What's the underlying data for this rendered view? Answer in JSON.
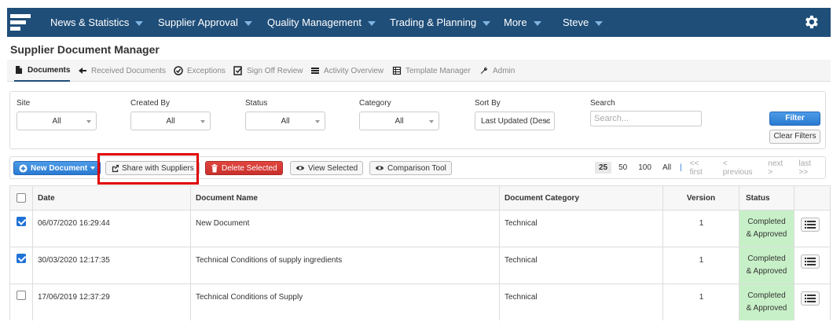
{
  "nav": {
    "items": [
      {
        "label": "News & Statistics"
      },
      {
        "label": "Supplier Approval"
      },
      {
        "label": "Quality Management"
      },
      {
        "label": "Trading & Planning"
      },
      {
        "label": "More"
      },
      {
        "label": "Steve"
      }
    ]
  },
  "page": {
    "title": "Supplier Document Manager"
  },
  "subnav": {
    "items": [
      {
        "label": "Documents",
        "icon": "document-icon"
      },
      {
        "label": "Received Documents",
        "icon": "arrow-left-icon"
      },
      {
        "label": "Exceptions",
        "icon": "check-circle-icon"
      },
      {
        "label": "Sign Off Review",
        "icon": "check-square-icon"
      },
      {
        "label": "Activity Overview",
        "icon": "list-icon"
      },
      {
        "label": "Template Manager",
        "icon": "table-icon"
      },
      {
        "label": "Admin",
        "icon": "wrench-icon"
      }
    ]
  },
  "filters": {
    "site": {
      "label": "Site",
      "value": "All"
    },
    "created_by": {
      "label": "Created By",
      "value": "All"
    },
    "status": {
      "label": "Status",
      "value": "All"
    },
    "category": {
      "label": "Category",
      "value": "All"
    },
    "sort_by": {
      "label": "Sort By",
      "value": "Last Updated (Desc"
    },
    "search": {
      "label": "Search",
      "placeholder": "Search..."
    },
    "filter_button": "Filter",
    "clear_button": "Clear Filters"
  },
  "toolbar": {
    "new_document": "New Document",
    "share": "Share with Suppliers",
    "delete": "Delete Selected",
    "view": "View Selected",
    "compare": "Comparison Tool"
  },
  "pager": {
    "sizes": [
      "25",
      "50",
      "100",
      "All"
    ],
    "separator": "|",
    "first": "<< first",
    "previous": "< previous",
    "next": "next >",
    "last": "last >>"
  },
  "table": {
    "headers": {
      "date": "Date",
      "name": "Document Name",
      "category": "Document Category",
      "version": "Version",
      "status": "Status"
    },
    "rows": [
      {
        "date": "06/07/2020 16:29:44",
        "name": "New Document",
        "category": "Technical",
        "version": "1",
        "status_line1": "Completed",
        "status_line2": "& Approved",
        "checked": true
      },
      {
        "date": "30/03/2020 12:17:35",
        "name": "Technical Conditions of supply ingredients",
        "category": "Technical",
        "version": "1",
        "status_line1": "Completed",
        "status_line2": "& Approved",
        "checked": true
      },
      {
        "date": "17/06/2019 12:37:29",
        "name": "Technical Conditions of Supply",
        "category": "Technical",
        "version": "1",
        "status_line1": "Completed",
        "status_line2": "& Approved",
        "checked": false
      }
    ]
  },
  "colors": {
    "navbar": "#1f4e79",
    "primary_button": "#2a7ad1",
    "danger_button": "#c9302c",
    "status_completed": "#c8f0c8",
    "highlight": "#e00000"
  }
}
